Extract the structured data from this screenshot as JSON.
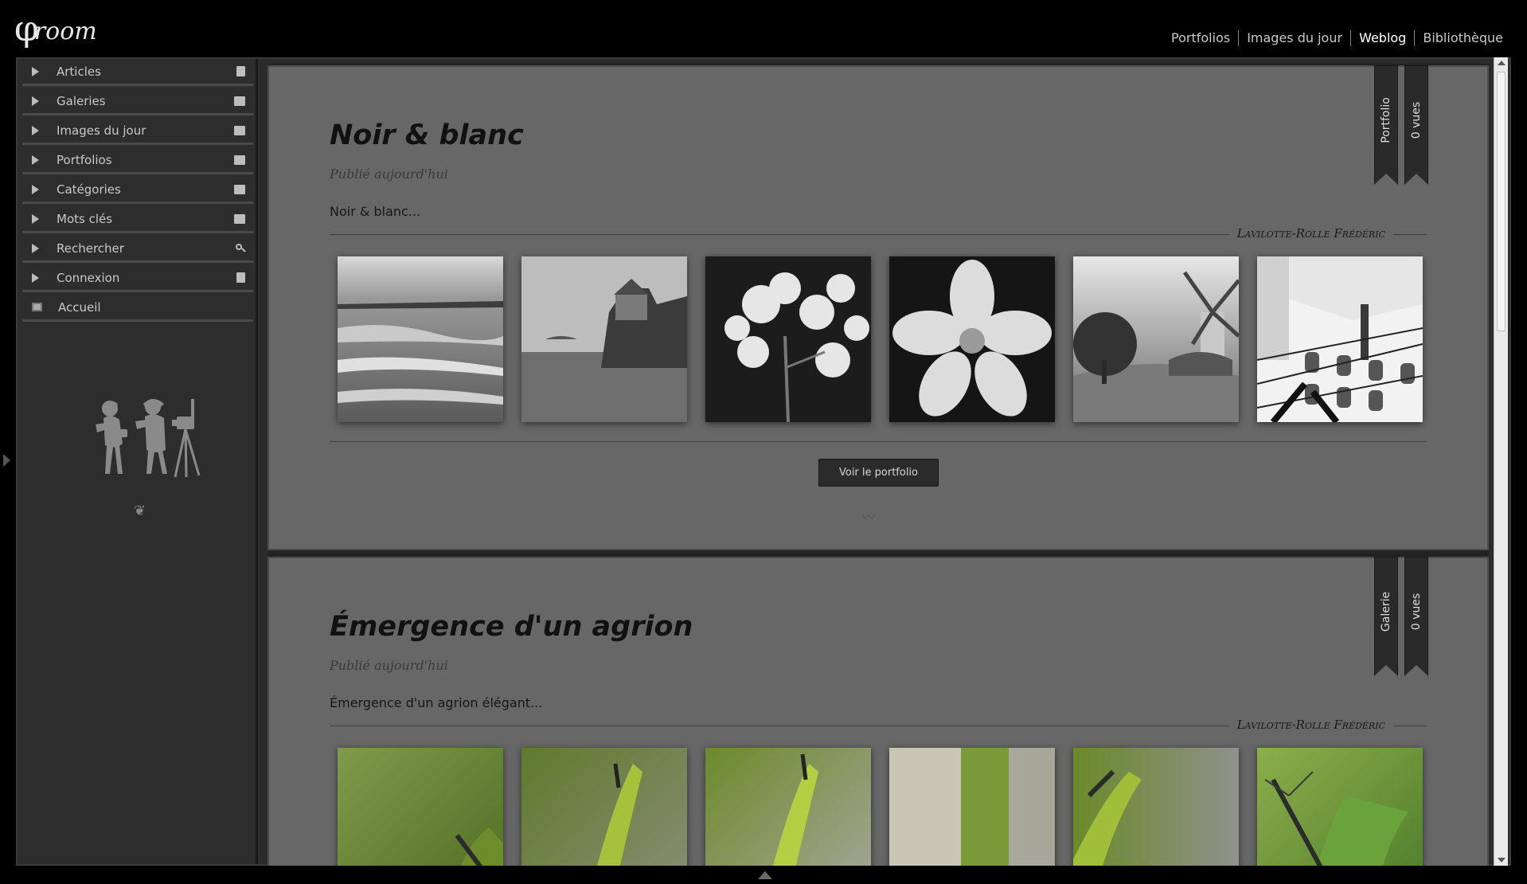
{
  "header": {
    "logo_symbol": "φ",
    "logo_text": "room",
    "nav": [
      {
        "label": "Portfolios",
        "active": false
      },
      {
        "label": "Images du jour",
        "active": false
      },
      {
        "label": "Weblog",
        "active": true
      },
      {
        "label": "Bibliothèque",
        "active": false
      }
    ]
  },
  "sidebar": {
    "items": [
      {
        "label": "Articles",
        "icon": "document-icon"
      },
      {
        "label": "Galeries",
        "icon": "folder-icon"
      },
      {
        "label": "Images du jour",
        "icon": "folder-icon"
      },
      {
        "label": "Portfolios",
        "icon": "folder-icon"
      },
      {
        "label": "Catégories",
        "icon": "list-icon"
      },
      {
        "label": "Mots clés",
        "icon": "tag-icon"
      },
      {
        "label": "Rechercher",
        "icon": "search-icon"
      },
      {
        "label": "Connexion",
        "icon": "document-icon"
      },
      {
        "label": "Accueil",
        "icon": "home-icon"
      }
    ],
    "ornament": "❦"
  },
  "posts": [
    {
      "title": "Noir & blanc",
      "date": "Publié aujourd'hui",
      "excerpt": "Noir & blanc...",
      "author": "Lavilotte-Rolle Frédéric",
      "type_ribbon": "Portfolio",
      "views_ribbon": "0 vues",
      "button": "Voir le portfolio",
      "squiggle": "〰"
    },
    {
      "title": "Émergence d'un agrion",
      "date": "Publié aujourd'hui",
      "excerpt": "Émergence d'un agrion élégant...",
      "author": "Lavilotte-Rolle Frédéric",
      "type_ribbon": "Galerie",
      "views_ribbon": "0 vues"
    }
  ],
  "colors": {
    "background": "#000000",
    "panel": "#676767",
    "sidebar": "#2d2d2d",
    "accent_text": "#ffffff"
  }
}
